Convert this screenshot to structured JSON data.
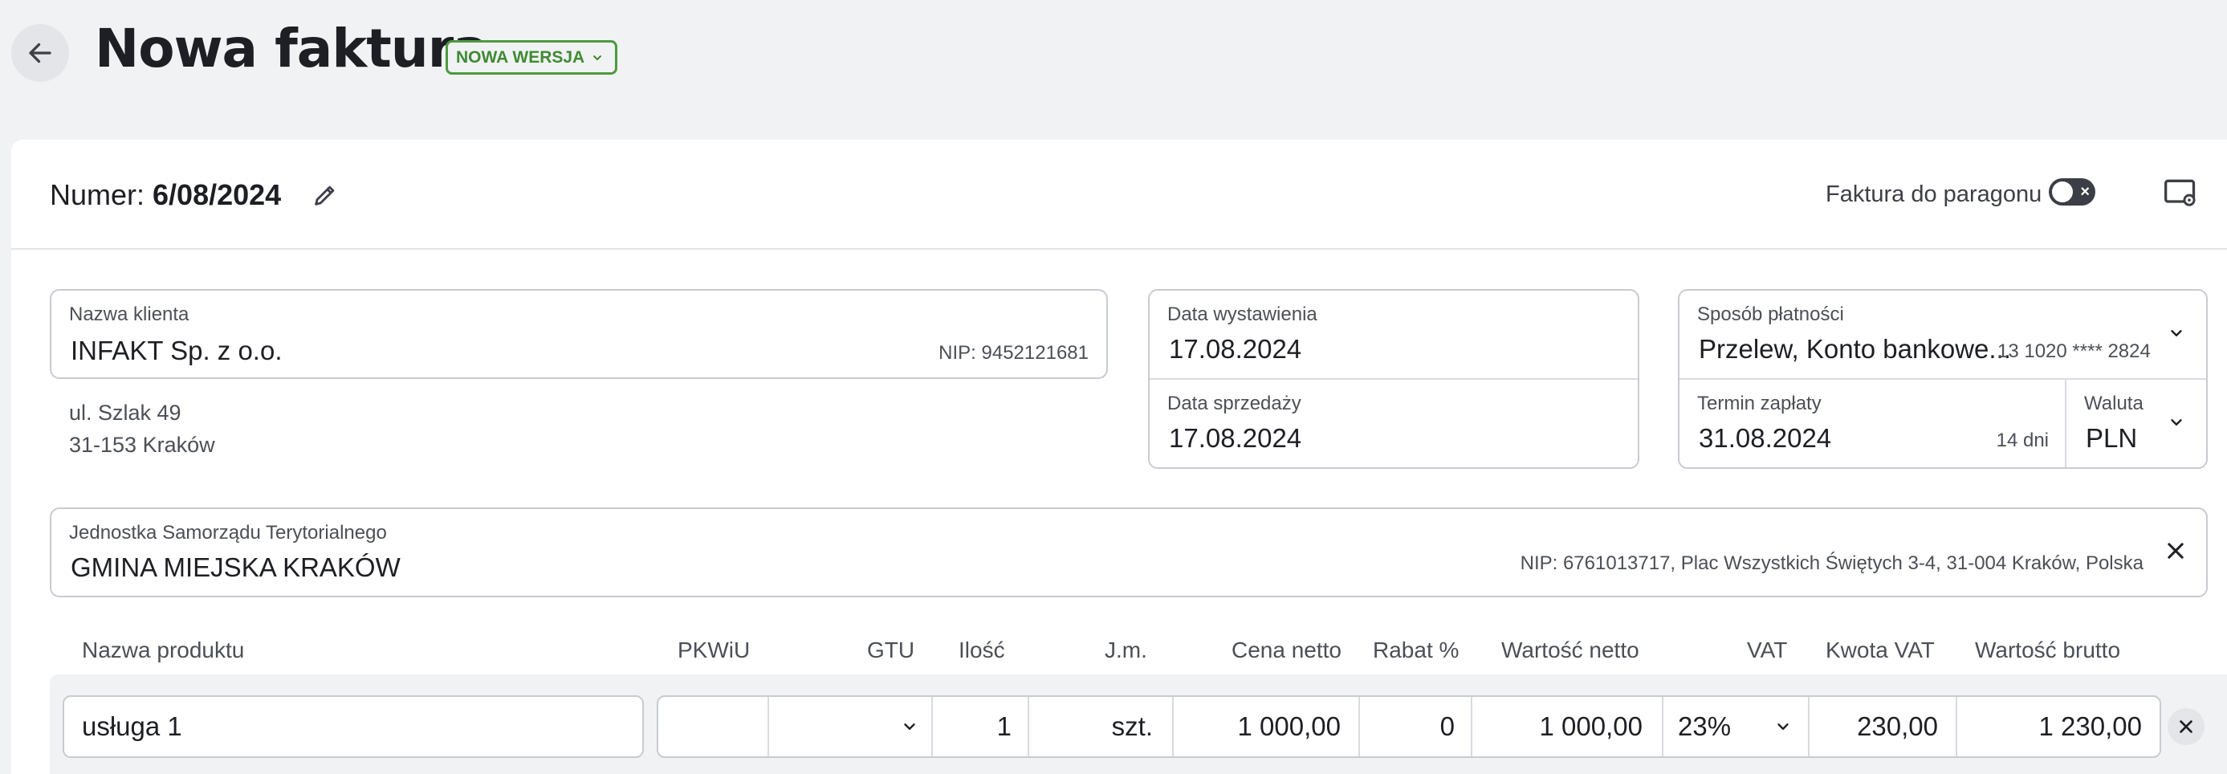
{
  "header": {
    "title": "Nowa faktura",
    "version_badge": "NOWA WERSJA"
  },
  "invoice": {
    "number_label": "Numer:",
    "number_value": "6/08/2024",
    "paragon_label": "Faktura do paragonu"
  },
  "client": {
    "label": "Nazwa klienta",
    "name": "INFAKT Sp. z o.o.",
    "nip": "NIP: 9452121681",
    "address_line1": "ul. Szlak 49",
    "address_line2": "31-153 Kraków"
  },
  "dates": {
    "issue_label": "Data wystawienia",
    "issue_value": "17.08.2024",
    "sale_label": "Data sprzedaży",
    "sale_value": "17.08.2024"
  },
  "payment": {
    "method_label": "Sposób płatności",
    "method_value": "Przelew, Konto bankowe...",
    "account": "13 1020 **** 2824",
    "due_label": "Termin zapłaty",
    "due_value": "31.08.2024",
    "due_days": "14 dni",
    "currency_label": "Waluta",
    "currency_value": "PLN"
  },
  "jst": {
    "label": "Jednostka Samorządu Terytorialnego",
    "name": "GMINA MIEJSKA KRAKÓW",
    "details": "NIP: 6761013717, Plac Wszystkich Świętych 3-4, 31-004 Kraków, Polska"
  },
  "table": {
    "columns": {
      "product": "Nazwa produktu",
      "pkwiu": "PKWiU",
      "gtu": "GTU",
      "qty": "Ilość",
      "unit": "J.m.",
      "net_price": "Cena netto",
      "discount": "Rabat %",
      "net_value": "Wartość netto",
      "vat": "VAT",
      "vat_amount": "Kwota VAT",
      "gross_value": "Wartość brutto"
    },
    "rows": [
      {
        "product": "usługa 1",
        "pkwiu": "",
        "gtu": "",
        "qty": "1",
        "unit": "szt.",
        "net_price": "1 000,00",
        "discount": "0",
        "net_value": "1 000,00",
        "vat": "23%",
        "vat_amount": "230,00",
        "gross_value": "1 230,00"
      }
    ]
  },
  "colors": {
    "accent_green": "#4c9a3f",
    "background": "#f1f2f4",
    "card": "#ffffff"
  }
}
